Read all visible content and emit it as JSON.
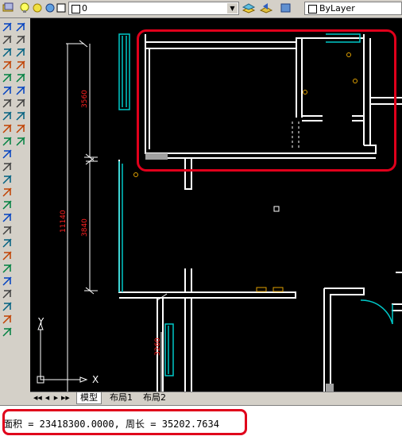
{
  "toolbar": {
    "layer_name": "0",
    "linetype_value": "ByLayer"
  },
  "left_toolbar": {
    "icons": [
      "line-icon",
      "xline-icon",
      "pline-icon",
      "polygon-icon",
      "rectangle-icon",
      "arc-icon",
      "circle-icon",
      "revcloud-icon",
      "spline-icon",
      "ellipse-icon",
      "ellipse-arc-icon",
      "insert-block-icon",
      "make-block-icon",
      "point-icon",
      "hatch-icon",
      "gradient-icon",
      "region-icon",
      "table-icon",
      "mtext-icon",
      "erase-icon",
      "copy-icon",
      "mirror-icon",
      "offset-icon",
      "array-icon",
      "move-icon",
      "rotate-icon",
      "scale-icon",
      "stretch-icon",
      "trim-icon",
      "extend-icon",
      "break-icon",
      "join-icon",
      "chamfer-icon",
      "fillet-icon",
      "explode-icon"
    ]
  },
  "drawing": {
    "dim_labels": [
      "3560",
      "3840",
      "11140",
      "3260"
    ],
    "ucs_x": "X",
    "ucs_y": "Y",
    "colors": {
      "background": "#000000",
      "walls": "#ffffff",
      "windows": "#00c8c8",
      "dimensions": "#ff0000",
      "highlight": "#e0001b"
    }
  },
  "layout_tabs": {
    "items": [
      "模型",
      "布局1",
      "布局2"
    ],
    "active": "模型"
  },
  "command_line": {
    "text": "面积 = 23418300.0000, 周长 = 35202.7634"
  }
}
